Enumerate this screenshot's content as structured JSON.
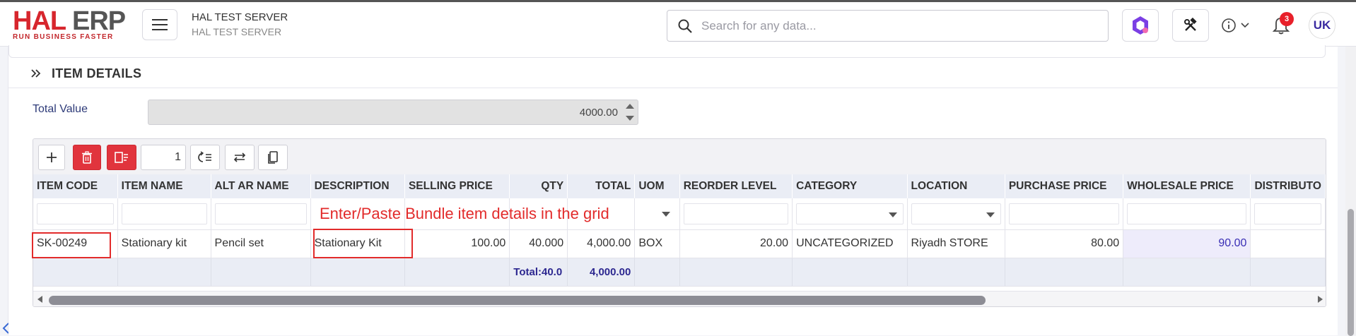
{
  "app": {
    "logo_main_1": "HAL",
    "logo_main_2": "ERP",
    "logo_tagline": "RUN BUSINESS FASTER",
    "server_title": "HAL TEST SERVER",
    "server_subtitle": "HAL TEST SERVER",
    "search_placeholder": "Search for any data...",
    "notification_count": "3",
    "avatar_initials": "UK"
  },
  "section": {
    "title": "ITEM DETAILS",
    "total_value_label": "Total Value",
    "total_value": "4000.00"
  },
  "grid": {
    "page_number": "1",
    "columns": [
      "ITEM CODE",
      "ITEM NAME",
      "ALT AR NAME",
      "DESCRIPTION",
      "SELLING PRICE",
      "QTY",
      "TOTAL",
      "UOM",
      "REORDER LEVEL",
      "CATEGORY",
      "LOCATION",
      "PURCHASE PRICE",
      "WHOLESALE PRICE",
      "DISTRIBUTO"
    ],
    "rows": [
      {
        "item_code": "SK-00249",
        "item_name": "Stationary kit",
        "alt_ar_name": "Pencil set",
        "description": "Stationary Kit",
        "selling_price": "100.00",
        "qty": "40.000",
        "total": "4,000.00",
        "uom": "BOX",
        "reorder_level": "20.00",
        "category": "UNCATEGORIZED",
        "location": "Riyadh STORE",
        "purchase_price": "80.00",
        "wholesale_price": "90.00",
        "distributor": ""
      }
    ],
    "footer": {
      "qty_total": "Total:40.0",
      "total": "4,000.00"
    }
  },
  "annotation": {
    "hint": "Enter/Paste Bundle item details in the grid"
  },
  "colors": {
    "brand_red": "#d7262d",
    "delete_red": "#e1343d",
    "accent_purple": "#3a2fb5",
    "annotation_red": "#e22b2b"
  }
}
